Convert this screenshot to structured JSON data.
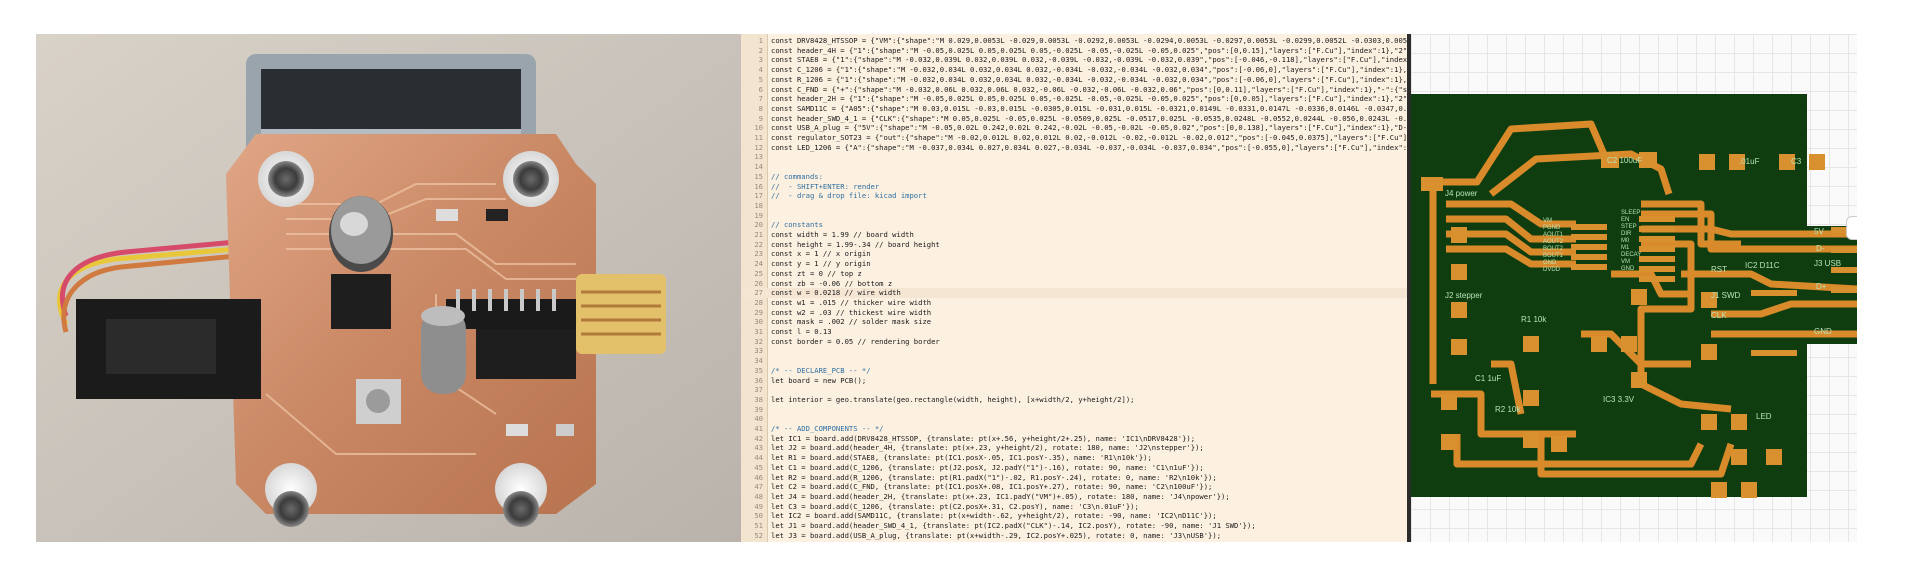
{
  "editor": {
    "lines": [
      {
        "n": "1",
        "text": "const DRV8428_HTSSOP = {\"VM\":{\"shape\":\"M 0.029,0.0053L -0.029,0.0053L -0.0292,0.0053L -0.0294,0.0053L -0.0297,0.0053L -0.0299,0.0052L -0.0303,0.0051L -0.0305,0.0051L"
      },
      {
        "n": "2",
        "text": "const header_4H = {\"1\":{\"shape\":\"M -0.05,0.025L 0.05,0.025L 0.05,-0.025L -0.05,-0.025L -0.05,0.025\",\"pos\":[0,0.15],\"layers\":[\"F.Cu\"],\"index\":1},\"2\":{\"shape\":\"M -0.05,"
      },
      {
        "n": "3",
        "text": "const STAE8 = {\"1\":{\"shape\":\"M -0.032,0.039L 0.032,0.039L 0.032,-0.039L -0.032,-0.039L -0.032,0.039\",\"pos\":[-0.046,-0.118],\"layers\":[\"F.Cu\"],\"index\":1},\"2\":{\"shape\":\""
      },
      {
        "n": "4",
        "text": "const C_1206 = {\"1\":{\"shape\":\"M -0.032,0.034L 0.032,0.034L 0.032,-0.034L -0.032,-0.034L -0.032,0.034\",\"pos\":[-0.06,0],\"layers\":[\"F.Cu\"],\"index\":1},\"2\":{\"shape\":\"M -0."
      },
      {
        "n": "5",
        "text": "const R_1206 = {\"1\":{\"shape\":\"M -0.032,0.034L 0.032,0.034L 0.032,-0.034L -0.032,-0.034L -0.032,0.034\",\"pos\":[-0.06,0],\"layers\":[\"F.Cu\"],\"index\":1},\"2\":{\"shape\":\"M -0."
      },
      {
        "n": "6",
        "text": "const C_FND = {\"+\":{\"shape\":\"M -0.032,0.06L 0.032,0.06L 0.032,-0.06L -0.032,-0.06L -0.032,0.06\",\"pos\":[0,0.11],\"layers\":[\"F.Cu\"],\"index\":1},\"-\":{\"shape\":\"M -0.032,0.0"
      },
      {
        "n": "7",
        "text": "const header_2H = {\"1\":{\"shape\":\"M -0.05,0.025L 0.05,0.025L 0.05,-0.025L -0.05,-0.025L -0.05,0.025\",\"pos\":[0,0.05],\"layers\":[\"F.Cu\"],\"index\":1},\"2\":{\"shape\":\"M -0.05,"
      },
      {
        "n": "8",
        "text": "const SAMD11C = {\"A05\":{\"shape\":\"M 0.03,0.015L -0.03,0.015L -0.0305,0.015L -0.031,0.015L -0.0321,0.0149L -0.0331,0.0147L -0.0336,0.0146L -0.0347,0.0142L -0.0356,0.013"
      },
      {
        "n": "9",
        "text": "const header_SWD_4_1 = {\"CLK\":{\"shape\":\"M 0.05,0.025L -0.05,0.025L -0.0509,0.025L -0.0517,0.025L -0.0535,0.0248L -0.0552,0.0244L -0.056,0.0243L -0.0578,0.0237L -0.059"
      },
      {
        "n": "10",
        "text": "const USB_A_plug = {\"5V\":{\"shape\":\"M -0.05,0.02L 0.242,0.02L 0.242,-0.02L -0.05,-0.02L -0.05,0.02\",\"pos\":[0,0.138],\"layers\":[\"F.Cu\"],\"index\":1},\"D-\":{\"shape\":\"M -0.05"
      },
      {
        "n": "11",
        "text": "const regulator_SOT23 = {\"out\":{\"shape\":\"M -0.02,0.012L 0.02,0.012L 0.02,-0.012L -0.02,-0.012L -0.02,0.012\",\"pos\":[-0.045,0.0375],\"layers\":[\"F.Cu\"],\"index\":1},\"in\":{"
      },
      {
        "n": "12",
        "text": "const LED_1206 = {\"A\":{\"shape\":\"M -0.037,0.034L 0.027,0.034L 0.027,-0.034L -0.037,-0.034L -0.037,0.034\",\"pos\":[-0.055,0],\"layers\":[\"F.Cu\"],\"index\":1},\"C\":{\"shape\":\"M"
      },
      {
        "n": "13",
        "text": ""
      },
      {
        "n": "14",
        "text": ""
      },
      {
        "n": "15",
        "text": "// commands:",
        "comment": true
      },
      {
        "n": "16",
        "text": "//  - SHIFT+ENTER: render",
        "comment": true
      },
      {
        "n": "17",
        "text": "//  - drag & drop file: kicad import",
        "comment": true
      },
      {
        "n": "18",
        "text": ""
      },
      {
        "n": "19",
        "text": ""
      },
      {
        "n": "20",
        "text": "// constants",
        "comment": true
      },
      {
        "n": "21",
        "text": "const width = 1.99 // board width"
      },
      {
        "n": "22",
        "text": "const height = 1.99-.34 // board height"
      },
      {
        "n": "23",
        "text": "const x = 1 // x origin"
      },
      {
        "n": "24",
        "text": "const y = 1 // y origin"
      },
      {
        "n": "25",
        "text": "const zt = 0 // top z"
      },
      {
        "n": "26",
        "text": "const zb = -0.06 // bottom z"
      },
      {
        "n": "27",
        "text": "const w = 0.0218 // wire width",
        "active": true
      },
      {
        "n": "28",
        "text": "const w1 = .015 // thicker wire width"
      },
      {
        "n": "29",
        "text": "const w2 = .03 // thickest wire width"
      },
      {
        "n": "30",
        "text": "const mask = .002 // solder mask size"
      },
      {
        "n": "31",
        "text": "const l = 0.13"
      },
      {
        "n": "32",
        "text": "const border = 0.05 // rendering border"
      },
      {
        "n": "33",
        "text": ""
      },
      {
        "n": "34",
        "text": ""
      },
      {
        "n": "35",
        "text": "/* -- DECLARE_PCB -- */",
        "comment": true
      },
      {
        "n": "36",
        "text": "let board = new PCB();"
      },
      {
        "n": "37",
        "text": ""
      },
      {
        "n": "38",
        "text": "let interior = geo.translate(geo.rectangle(width, height), [x+width/2, y+height/2]);"
      },
      {
        "n": "39",
        "text": ""
      },
      {
        "n": "40",
        "text": ""
      },
      {
        "n": "41",
        "text": "/* -- ADD_COMPONENTS -- */",
        "comment": true
      },
      {
        "n": "42",
        "text": "let IC1 = board.add(DRV8428_HTSSOP, {translate: pt(x+.56, y+height/2+.25), name: 'IC1\\nDRV8428'});"
      },
      {
        "n": "43",
        "text": "let J2 = board.add(header_4H, {translate: pt(x+.23, y+height/2), rotate: 180, name: 'J2\\nstepper'});"
      },
      {
        "n": "44",
        "text": "let R1 = board.add(STAE8, {translate: pt(IC1.posX-.05, IC1.posY-.35), name: 'R1\\n10k'});"
      },
      {
        "n": "45",
        "text": "let C1 = board.add(C_1206, {translate: pt(J2.posX, J2.padY(\"1\")-.16), rotate: 90, name: 'C1\\n1uF'});"
      },
      {
        "n": "46",
        "text": "let R2 = board.add(R_1206, {translate: pt(R1.padX(\"1\")-.02, R1.posY-.24), rotate: 0, name: 'R2\\n10k'});"
      },
      {
        "n": "47",
        "text": "let C2 = board.add(C_FND, {translate: pt(IC1.posX+.08, IC1.posY+.27), rotate: 90, name: 'C2\\n100uF'});"
      },
      {
        "n": "48",
        "text": "let J4 = board.add(header_2H, {translate: pt(x+.23, IC1.padY(\"VM\")+.05), rotate: 180, name: 'J4\\npower'});"
      },
      {
        "n": "49",
        "text": "let C3 = board.add(C_1206, {translate: pt(C2.posX+.31, C2.posY), name: 'C3\\n.01uF'});"
      },
      {
        "n": "50",
        "text": "let IC2 = board.add(SAMD11C, {translate: pt(x+width-.62, y+height/2), rotate: -90, name: 'IC2\\nD11C'});"
      },
      {
        "n": "51",
        "text": "let J1 = board.add(header_SWD_4_1, {translate: pt(IC2.padX(\"CLK\")-.14, IC2.posY), rotate: -90, name: 'J1 SWD'});"
      },
      {
        "n": "52",
        "text": "let J3 = board.add(USB_A_plug, {translate: pt(x+width-.29, IC2.posY+.025), rotate: 0, name: 'J3\\nUSB'});"
      }
    ]
  },
  "pcb": {
    "colors": {
      "board": "#0f3d0f",
      "copper": "#d98a2a",
      "pad": "#d9912f",
      "label": "#b7e3b7"
    },
    "labels": {
      "c2": "C2 100uF",
      "c3": ".01uF",
      "c3_ref": "C3",
      "j4": "J4 power",
      "j2": "J2 stepper",
      "r1": "R1 10k",
      "j1": "J1 SWD",
      "j3": "J3 USB",
      "r2": "R2 10k",
      "c1": "C1 1uF",
      "led": "LED",
      "reg": "IC3 3.3V",
      "v5": "5V",
      "gnd": "GND",
      "dm": "D-",
      "dp": "D+",
      "rst": "RST",
      "clk": "CLK",
      "ic2": "IC2 D11C",
      "ic1_pins": [
        "VM",
        "PGND",
        "AOUT1",
        "AOUT2",
        "BOUT2",
        "BOUT1",
        "GND",
        "DVDD"
      ],
      "ic1_pins_r": [
        "SLEEP",
        "EN",
        "STEP",
        "DIR",
        "M0",
        "M1",
        "DECAY",
        "VM",
        "GND"
      ]
    }
  }
}
